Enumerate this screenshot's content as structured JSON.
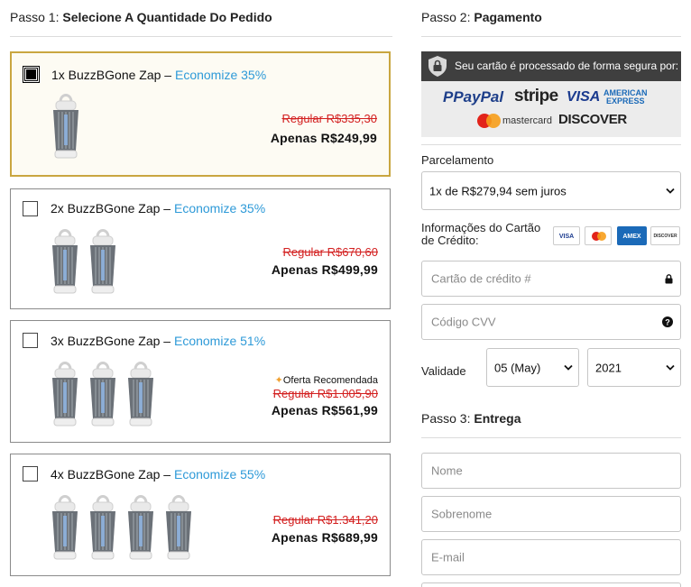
{
  "step1": {
    "prefix": "Passo 1:",
    "title": "Selecione A Quantidade Do Pedido"
  },
  "products": [
    {
      "title": "1x BuzzBGone Zap",
      "sep": " – ",
      "discount": "Economize 35%",
      "regular": "Regular R$335,30",
      "price": "Apenas R$249,99",
      "selected": true,
      "qty": 1
    },
    {
      "title": "2x BuzzBGone Zap",
      "sep": " – ",
      "discount": "Economize 35%",
      "regular": "Regular R$670,60",
      "price": "Apenas R$499,99",
      "selected": false,
      "qty": 2
    },
    {
      "title": "3x BuzzBGone Zap",
      "sep": " – ",
      "discount": "Economize 51%",
      "badge": "Oferta Recomendada",
      "regular": "Regular R$1.005,90",
      "price": "Apenas R$561,99",
      "selected": false,
      "qty": 3
    },
    {
      "title": "4x BuzzBGone Zap",
      "sep": " – ",
      "discount": "Economize 55%",
      "regular": "Regular R$1.341,20",
      "price": "Apenas R$689,99",
      "selected": false,
      "qty": 4
    }
  ],
  "step2": {
    "prefix": "Passo 2:",
    "title": "Pagamento"
  },
  "secure_text": "Seu cartão é processado de forma segura por:",
  "brand_logos": {
    "paypal": "PayPal",
    "stripe": "stripe",
    "visa": "VISA",
    "amex_line1": "AMERICAN",
    "amex_line2": "EXPRESS",
    "mastercard": "mastercard",
    "discover": "DISCOVER"
  },
  "installments": {
    "label": "Parcelamento",
    "value": "1x de R$279,94 sem juros"
  },
  "card_info": {
    "label": "Informações do Cartão de Crédito:",
    "mini_logos": {
      "visa": "VISA",
      "amex": "AMEX",
      "discover": "DISCOVER"
    },
    "card_placeholder": "Cartão de crédito #",
    "cvv_placeholder": "Código CVV"
  },
  "validity": {
    "label": "Validade",
    "month": "05 (May)",
    "year": "2021"
  },
  "step3": {
    "prefix": "Passo 3:",
    "title": "Entrega"
  },
  "delivery": {
    "first_name": "Nome",
    "last_name": "Sobrenome",
    "email": "E-mail"
  },
  "colors": {
    "accent_gold": "#c9a640",
    "discount_blue": "#2e9ad8",
    "strike_red": "#d32020",
    "secure_bar": "#3f3f3f"
  }
}
